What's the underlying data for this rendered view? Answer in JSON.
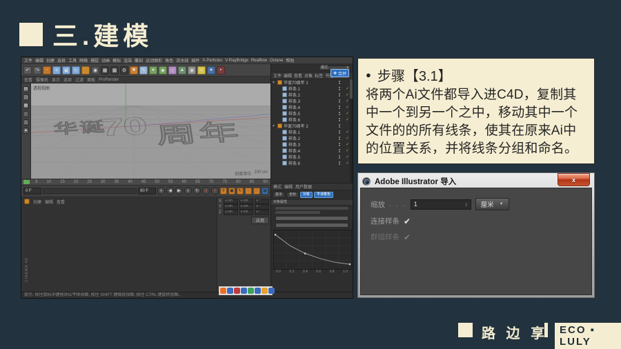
{
  "colors": {
    "slide_bg": "#22323e",
    "accent_cream": "#f5edd1",
    "c4d_panel": "#3a3a3a",
    "viewport_gray": "#9b9b9b",
    "highlight_blue": "#2f6fbe",
    "close_red": "#b33418",
    "axis_x_red": "#b05a5a",
    "axis_y_green": "#6a9a6a",
    "axis_z_blue": "#7070b8"
  },
  "slide": {
    "title": "三.建模"
  },
  "step_box": {
    "bullet": "●",
    "heading": "步骤【3.1】",
    "body": "将两个Ai文件都导入进C4D，复制其中一个到另一个之中，移动其中一个文件的的所有线条，使其在原来Ai中的位置关系，并将线条分组和命名。"
  },
  "dialog": {
    "title": "Adobe Illustrator 导入",
    "close_glyph": "x",
    "scale_label": "缩放",
    "scale_leader": ". . .",
    "scale_value": "1",
    "spinner_glyph": "↕",
    "unit_value": "厘米",
    "unit_caret": "▼",
    "checkbox_connect": {
      "label": "连接样条",
      "check": "✔",
      "checked": true
    },
    "checkbox_group": {
      "label": "群组样条",
      "check": "✔",
      "checked": true,
      "disabled": true
    }
  },
  "footer": {
    "brand": "路 边 享",
    "badge": "ECO ▪ LULY"
  },
  "c4d": {
    "brand_vertical": "CINEMA 4D",
    "menus": [
      "文件",
      "编辑",
      "创建",
      "选择",
      "工具",
      "网格",
      "捕捉",
      "动画",
      "模拟",
      "渲染",
      "雕刻",
      "运动图形",
      "角色",
      "流水线",
      "插件",
      "X-Particles",
      "V-RayBridge",
      "Realflow",
      "Octane",
      "帮助"
    ],
    "toolbar_icons": [
      {
        "name": "undo-icon",
        "color": "#5a5a5a",
        "glyph": "↶"
      },
      {
        "name": "redo-icon",
        "color": "#5a5a5a",
        "glyph": "↷"
      },
      {
        "name": "live-selection-icon",
        "color": "#c7762b",
        "glyph": "◦"
      },
      {
        "name": "move-icon",
        "color": "#7fa8d9",
        "glyph": "✛"
      },
      {
        "name": "scale-icon",
        "color": "#7fa8d9",
        "glyph": "▣"
      },
      {
        "name": "rotate-icon",
        "color": "#7fa8d9",
        "glyph": "↻"
      },
      {
        "name": "last-tool-icon",
        "color": "#c98a2e",
        "glyph": ""
      },
      {
        "name": "coord-system-icon",
        "color": "#555555",
        "glyph": "◉"
      },
      {
        "name": "render-view-icon",
        "color": "#3b3b3b",
        "glyph": "▦"
      },
      {
        "name": "render-picture-icon",
        "color": "#3b3b3b",
        "glyph": "▦"
      },
      {
        "name": "render-settings-icon",
        "color": "#3b3b3b",
        "glyph": "⚙"
      },
      {
        "name": "cube-primitive-icon",
        "color": "#cd7f32",
        "glyph": "■"
      },
      {
        "name": "spline-pen-icon",
        "color": "#9bb7d4",
        "glyph": "✎"
      },
      {
        "name": "subdivision-icon",
        "color": "#76a05e",
        "glyph": "●"
      },
      {
        "name": "array-icon",
        "color": "#76a05e",
        "glyph": "◆"
      },
      {
        "name": "deformer-icon",
        "color": "#b08cc0",
        "glyph": "◇"
      },
      {
        "name": "environment-icon",
        "color": "#6f8f6f",
        "glyph": "▲"
      },
      {
        "name": "camera-icon",
        "color": "#8f8f8f",
        "glyph": "◉"
      },
      {
        "name": "light-icon",
        "color": "#d8c24a",
        "glyph": "☀"
      },
      {
        "name": "material-icon",
        "color": "#4a6fa5",
        "glyph": "●"
      },
      {
        "name": "xpresso-icon",
        "color": "#7a3c3c",
        "glyph": "▪"
      }
    ],
    "rail_icons": [
      {
        "name": "make-editable-icon",
        "glyph": "▤"
      },
      {
        "name": "model-mode-icon",
        "glyph": "◳"
      },
      {
        "name": "texture-mode-icon",
        "glyph": "▩"
      },
      {
        "name": "points-mode-icon",
        "glyph": "∴"
      },
      {
        "name": "edges-mode-icon",
        "glyph": "△"
      },
      {
        "name": "polygons-mode-icon",
        "glyph": "▲"
      }
    ],
    "viewport": {
      "menu": [
        "查看",
        "摄像机",
        "显示",
        "选项",
        "过滤",
        "面板",
        "ProRender"
      ],
      "label": "透视视图",
      "scale_label": "刻度单位",
      "scale_value": "100 cm",
      "wireframe_text": {
        "part1": "华诞",
        "part2": "70",
        "part3": "周年"
      }
    },
    "object_manager": {
      "mode_label": "模式",
      "mode_caret": "▾",
      "menus": [
        "文件",
        "编辑",
        "查看",
        "对象",
        "标签",
        "书签"
      ],
      "search_glyph": "🔍",
      "tooltip_glyph": "✚",
      "tooltip_label": "合并",
      "rows": [
        {
          "kind": "group",
          "twist": "▾",
          "label": "华诞70周年 1",
          "check": ""
        },
        {
          "kind": "child",
          "twist": "",
          "label": "样条.1",
          "check": "✓"
        },
        {
          "kind": "child",
          "twist": "",
          "label": "样条.2",
          "check": "✓"
        },
        {
          "kind": "child",
          "twist": "",
          "label": "样条.3",
          "check": "✓"
        },
        {
          "kind": "child",
          "twist": "",
          "label": "样条.4",
          "check": "✓"
        },
        {
          "kind": "child",
          "twist": "",
          "label": "样条.5",
          "check": "✓"
        },
        {
          "kind": "child",
          "twist": "",
          "label": "样条.6",
          "check": "✓"
        },
        {
          "kind": "group",
          "twist": "▾",
          "label": "华诞70周年 2",
          "check": ""
        },
        {
          "kind": "child",
          "twist": "",
          "label": "样条.1",
          "check": "✓"
        },
        {
          "kind": "child",
          "twist": "",
          "label": "样条.2",
          "check": "✓"
        },
        {
          "kind": "child",
          "twist": "",
          "label": "样条.3",
          "check": "✓"
        },
        {
          "kind": "child",
          "twist": "",
          "label": "样条.4",
          "check": "✓"
        },
        {
          "kind": "child",
          "twist": "",
          "label": "样条.5",
          "check": "✓"
        },
        {
          "kind": "child",
          "twist": "",
          "label": "样条.6",
          "check": "✓"
        }
      ]
    },
    "attributes": {
      "menus": [
        "模式",
        "编辑",
        "用户数据"
      ],
      "tabs": [
        {
          "label": "基本",
          "active": false
        },
        {
          "label": "坐标",
          "active": false
        },
        {
          "label": "对象",
          "active": true
        },
        {
          "label": "平滑着色",
          "active": true
        }
      ],
      "section": "对象属性",
      "curve": {
        "type": "line",
        "x_labels": [
          "0.0",
          "0.2",
          "0.4",
          "0.6",
          "0.8",
          "1.0"
        ],
        "points": [
          [
            0,
            0.95
          ],
          [
            0.2,
            0.6
          ],
          [
            0.4,
            0.36
          ],
          [
            0.6,
            0.2
          ],
          [
            0.8,
            0.08
          ],
          [
            1,
            0.02
          ]
        ]
      }
    },
    "timeline": {
      "ticks": [
        0,
        5,
        10,
        15,
        20,
        25,
        30,
        35,
        40,
        45,
        50,
        55,
        60,
        65,
        70,
        75,
        80,
        85,
        90
      ],
      "frame_field": "0 F",
      "end_field": "90 F"
    },
    "transport_buttons": [
      {
        "name": "goto-start-icon",
        "glyph": "«"
      },
      {
        "name": "prev-frame-icon",
        "glyph": "◀"
      },
      {
        "name": "play-icon",
        "glyph": "▶"
      },
      {
        "name": "next-frame-icon",
        "glyph": "»"
      },
      {
        "name": "loop-icon",
        "glyph": "↻"
      }
    ],
    "record_buttons": [
      {
        "name": "record-keyframe-icon",
        "color": "#c24038"
      },
      {
        "name": "autokey-icon",
        "color": "#c24038"
      }
    ],
    "key_chips": [
      {
        "name": "record-position-icon",
        "color": "#c87d2e",
        "glyph": "✛"
      },
      {
        "name": "record-scale-icon",
        "color": "#c87d2e",
        "glyph": "▣"
      },
      {
        "name": "record-rotation-icon",
        "color": "#c87d2e",
        "glyph": "↻"
      },
      {
        "name": "record-param-icon",
        "color": "#c87d2e",
        "glyph": "◦"
      },
      {
        "name": "record-pla-icon",
        "color": "#c87d2e",
        "glyph": "∴"
      },
      {
        "name": "keyframe-selection-icon",
        "color": "#3f6fae",
        "glyph": "▦"
      }
    ],
    "materials": {
      "menus": [
        "创建",
        "编辑",
        "查看"
      ]
    },
    "coordinates": {
      "rows": [
        {
          "axis": "X",
          "v1": "0 cm",
          "v2": "0 cm",
          "v3": "0 °"
        },
        {
          "axis": "Y",
          "v1": "0 cm",
          "v2": "0 cm",
          "v3": "0 °"
        },
        {
          "axis": "Z",
          "v1": "0 cm",
          "v2": "0 cm",
          "v3": "0 °"
        }
      ],
      "apply": "应用"
    },
    "watermark_icons": [
      {
        "name": "watermark-logo-icon",
        "color": "#e8702a"
      },
      {
        "name": "watermark-glyph",
        "color": "#3a6bbf"
      },
      {
        "name": "watermark-glyph",
        "color": "#c23b3b"
      },
      {
        "name": "watermark-glyph",
        "color": "#3a6bbf"
      },
      {
        "name": "watermark-glyph",
        "color": "#3fa05a"
      },
      {
        "name": "watermark-glyph",
        "color": "#3a6bbf"
      },
      {
        "name": "watermark-glyph",
        "color": "#e8a02a"
      },
      {
        "name": "watermark-glyph",
        "color": "#3a6bbf"
      }
    ],
    "status_text": "提示: 按住鼠标中键拖动以平移视图, 按住 SHIFT 键缩放视图, 按住 CTRL 键旋转视图。"
  }
}
